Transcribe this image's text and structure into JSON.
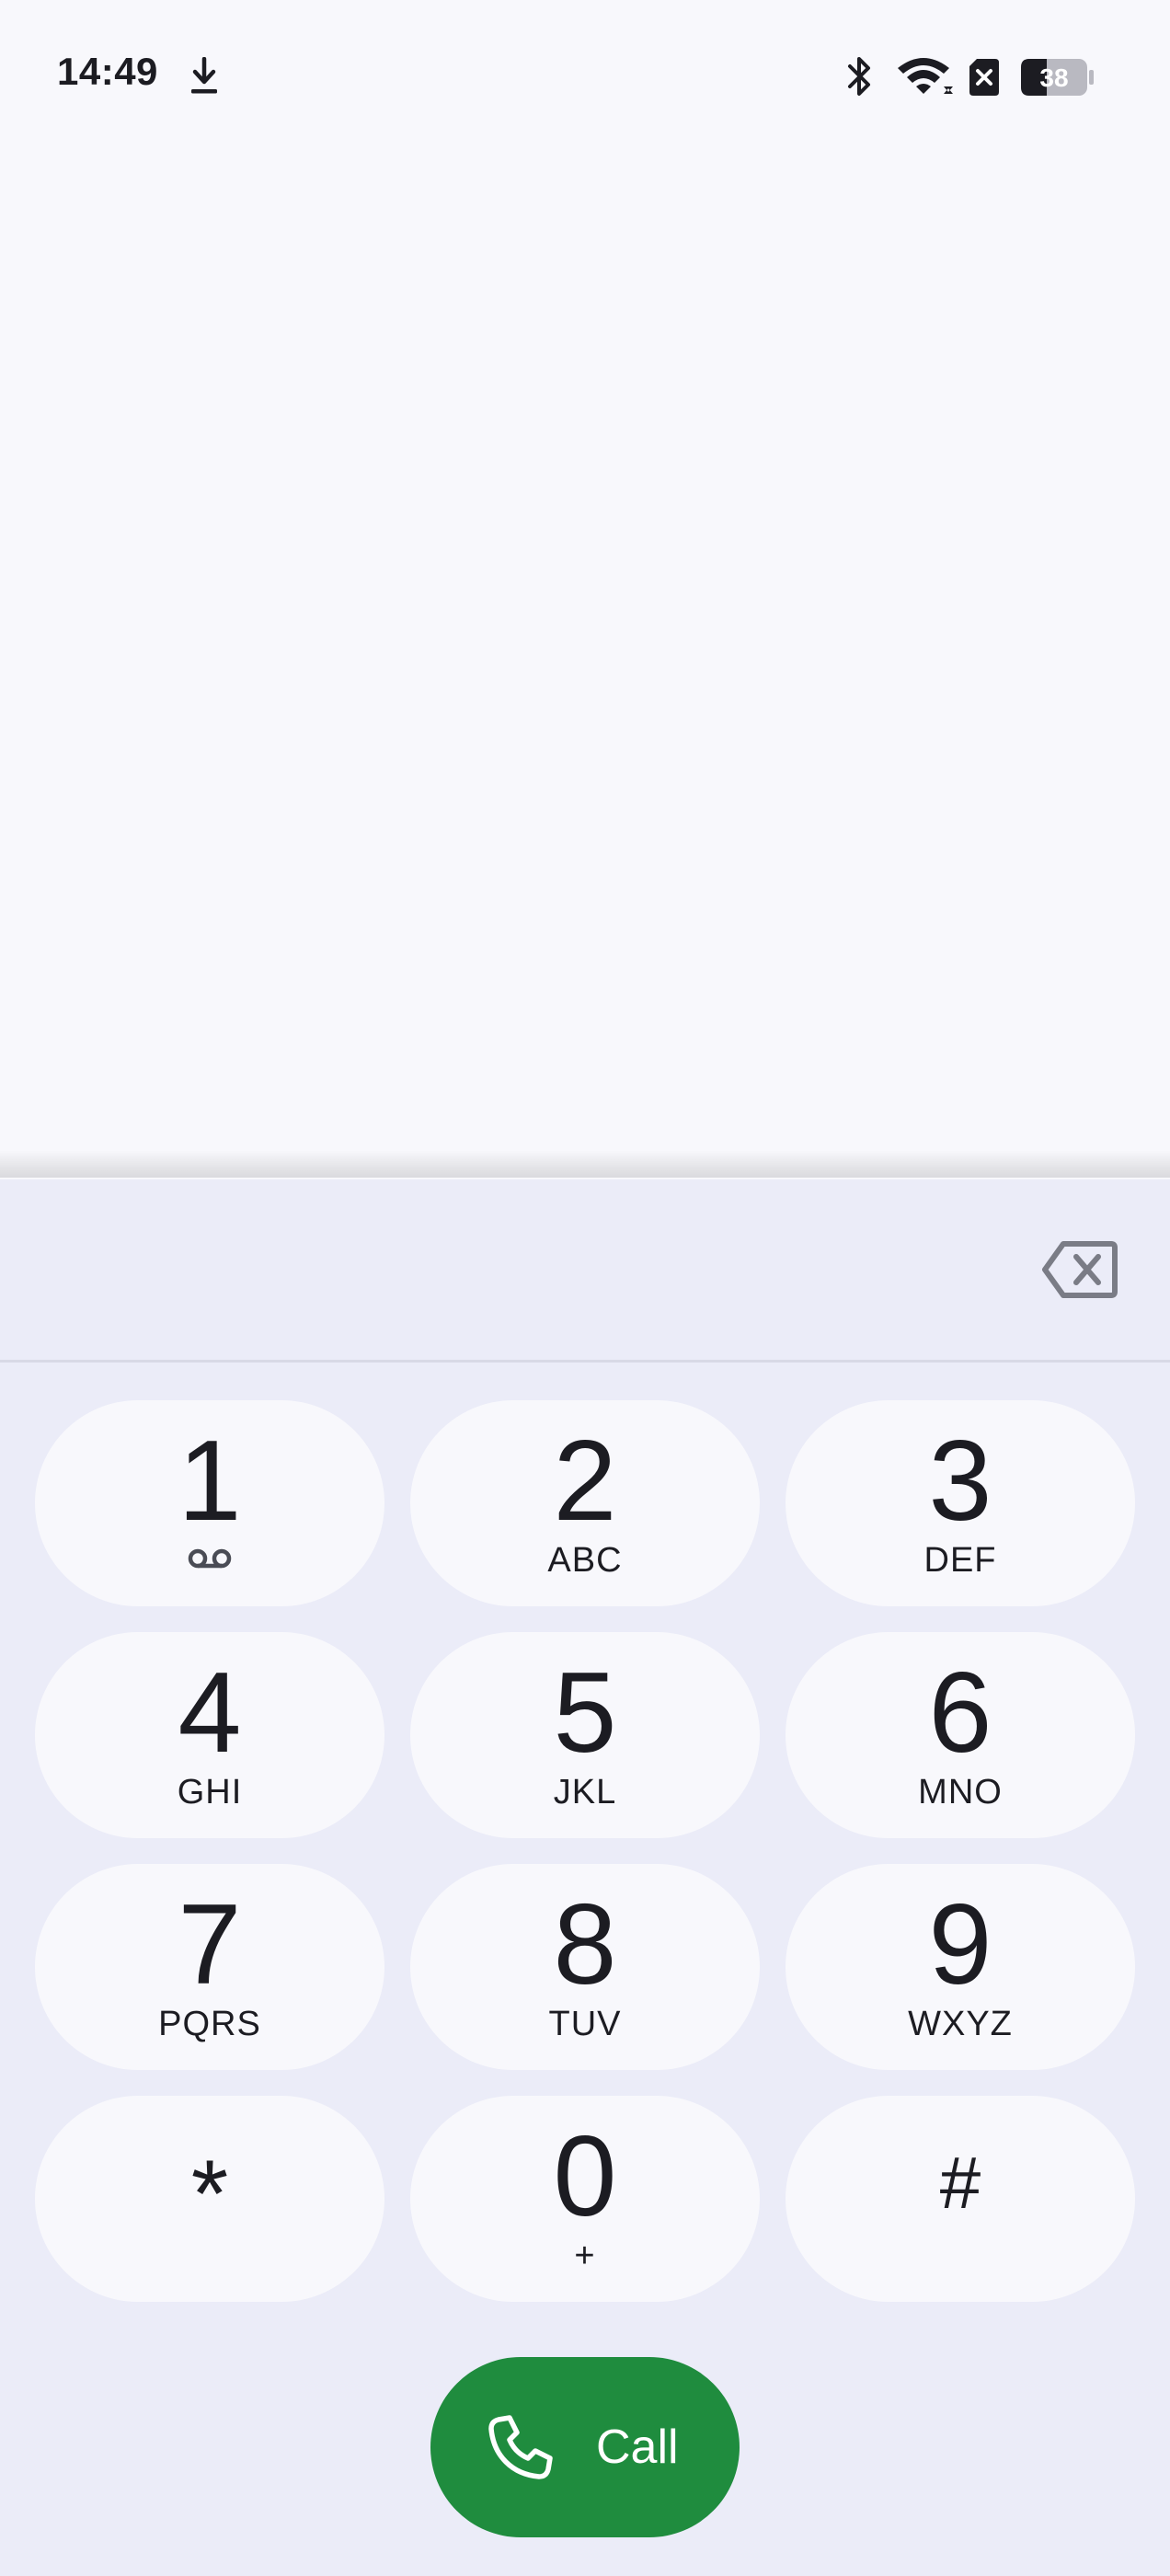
{
  "status_bar": {
    "time": "14:49",
    "icons": [
      "download-icon",
      "bluetooth-icon",
      "wifi-icon",
      "sim-off-icon",
      "battery-icon"
    ],
    "battery_level": "38"
  },
  "dialer": {
    "number_value": "",
    "backspace_icon": "backspace-icon",
    "keys": [
      {
        "digit": "1",
        "letters": "",
        "icon": "voicemail-icon"
      },
      {
        "digit": "2",
        "letters": "ABC"
      },
      {
        "digit": "3",
        "letters": "DEF"
      },
      {
        "digit": "4",
        "letters": "GHI"
      },
      {
        "digit": "5",
        "letters": "JKL"
      },
      {
        "digit": "6",
        "letters": "MNO"
      },
      {
        "digit": "7",
        "letters": "PQRS"
      },
      {
        "digit": "8",
        "letters": "TUV"
      },
      {
        "digit": "9",
        "letters": "WXYZ"
      },
      {
        "digit": "*",
        "letters": ""
      },
      {
        "digit": "0",
        "letters": "+"
      },
      {
        "digit": "#",
        "letters": ""
      }
    ],
    "call_label": "Call"
  },
  "colors": {
    "background": "#f8f8fc",
    "dialpad_background": "#ebecf8",
    "key_background": "#f8f8fc",
    "call_button": "#1f8c3e",
    "text": "#1c1c22"
  }
}
